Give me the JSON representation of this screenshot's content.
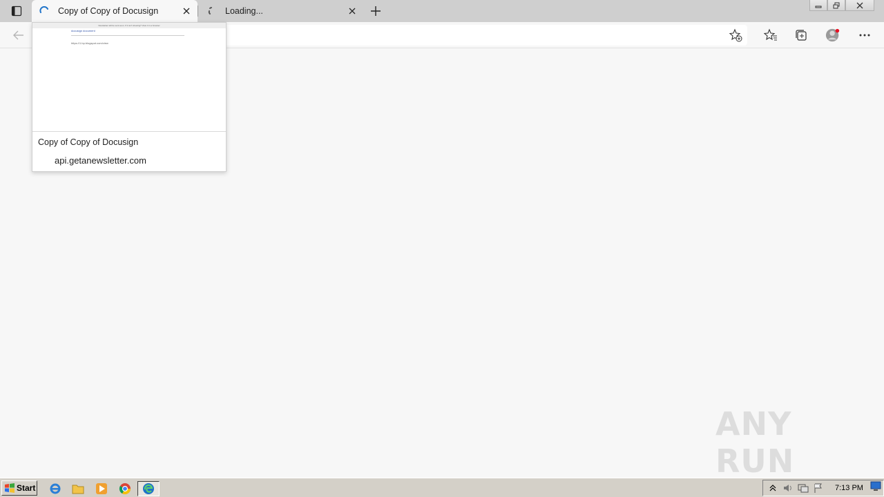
{
  "tabs": [
    {
      "title": "Copy of Copy of Docusign",
      "state": "active"
    },
    {
      "title": "Loading...",
      "state": "loading"
    }
  ],
  "preview": {
    "title": "Copy of Copy of Docusign",
    "url": "api.getanewsletter.com",
    "thumb_banner": "Newsletter will be sent soon. If it isn't showing? View it in a browser",
    "thumb_img1": "docusign document",
    "thumb_img2": "https://1.bp.blogspot.com/view"
  },
  "watermark": {
    "text": "ANY RUN"
  },
  "taskbar": {
    "start_label": "Start",
    "clock": "7:13 PM"
  },
  "colors": {
    "edge_blue": "#1e73c9",
    "profile_red": "#e81123"
  }
}
